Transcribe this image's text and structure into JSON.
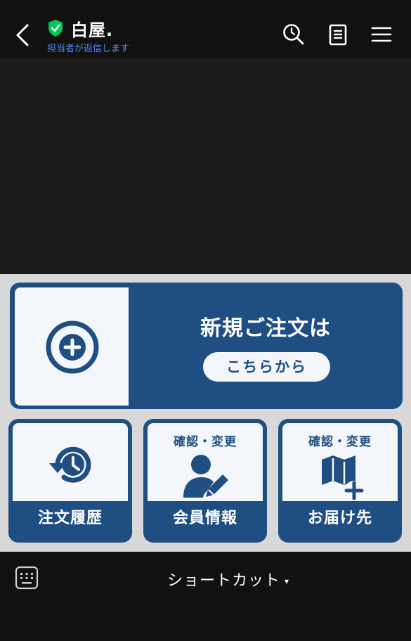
{
  "header": {
    "title": "白屋.",
    "subtitle": "担当者が返信します",
    "icons": [
      "back-icon",
      "verified-shield-icon",
      "search-icon",
      "notes-icon",
      "menu-icon"
    ]
  },
  "rich_menu": {
    "new_order": {
      "heading": "新規ご注文は",
      "button_label": "こちらから",
      "icon": "plus-circle-icon"
    },
    "tiles": [
      {
        "top_label": "",
        "label": "注文履歴",
        "icon": "history-icon"
      },
      {
        "top_label": "確認・変更",
        "label": "会員情報",
        "icon": "user-edit-icon"
      },
      {
        "top_label": "確認・変更",
        "label": "お届け先",
        "icon": "map-add-icon"
      }
    ],
    "colors": {
      "primary": "#1f4f82",
      "panel": "#f3f6fa",
      "background": "#d8d8d8"
    }
  },
  "bottom_bar": {
    "label": "ショートカット",
    "caret": "▾",
    "icon": "keyboard-icon"
  },
  "colors": {
    "accent_blue": "#4a86f5",
    "verified_green": "#06c755"
  }
}
